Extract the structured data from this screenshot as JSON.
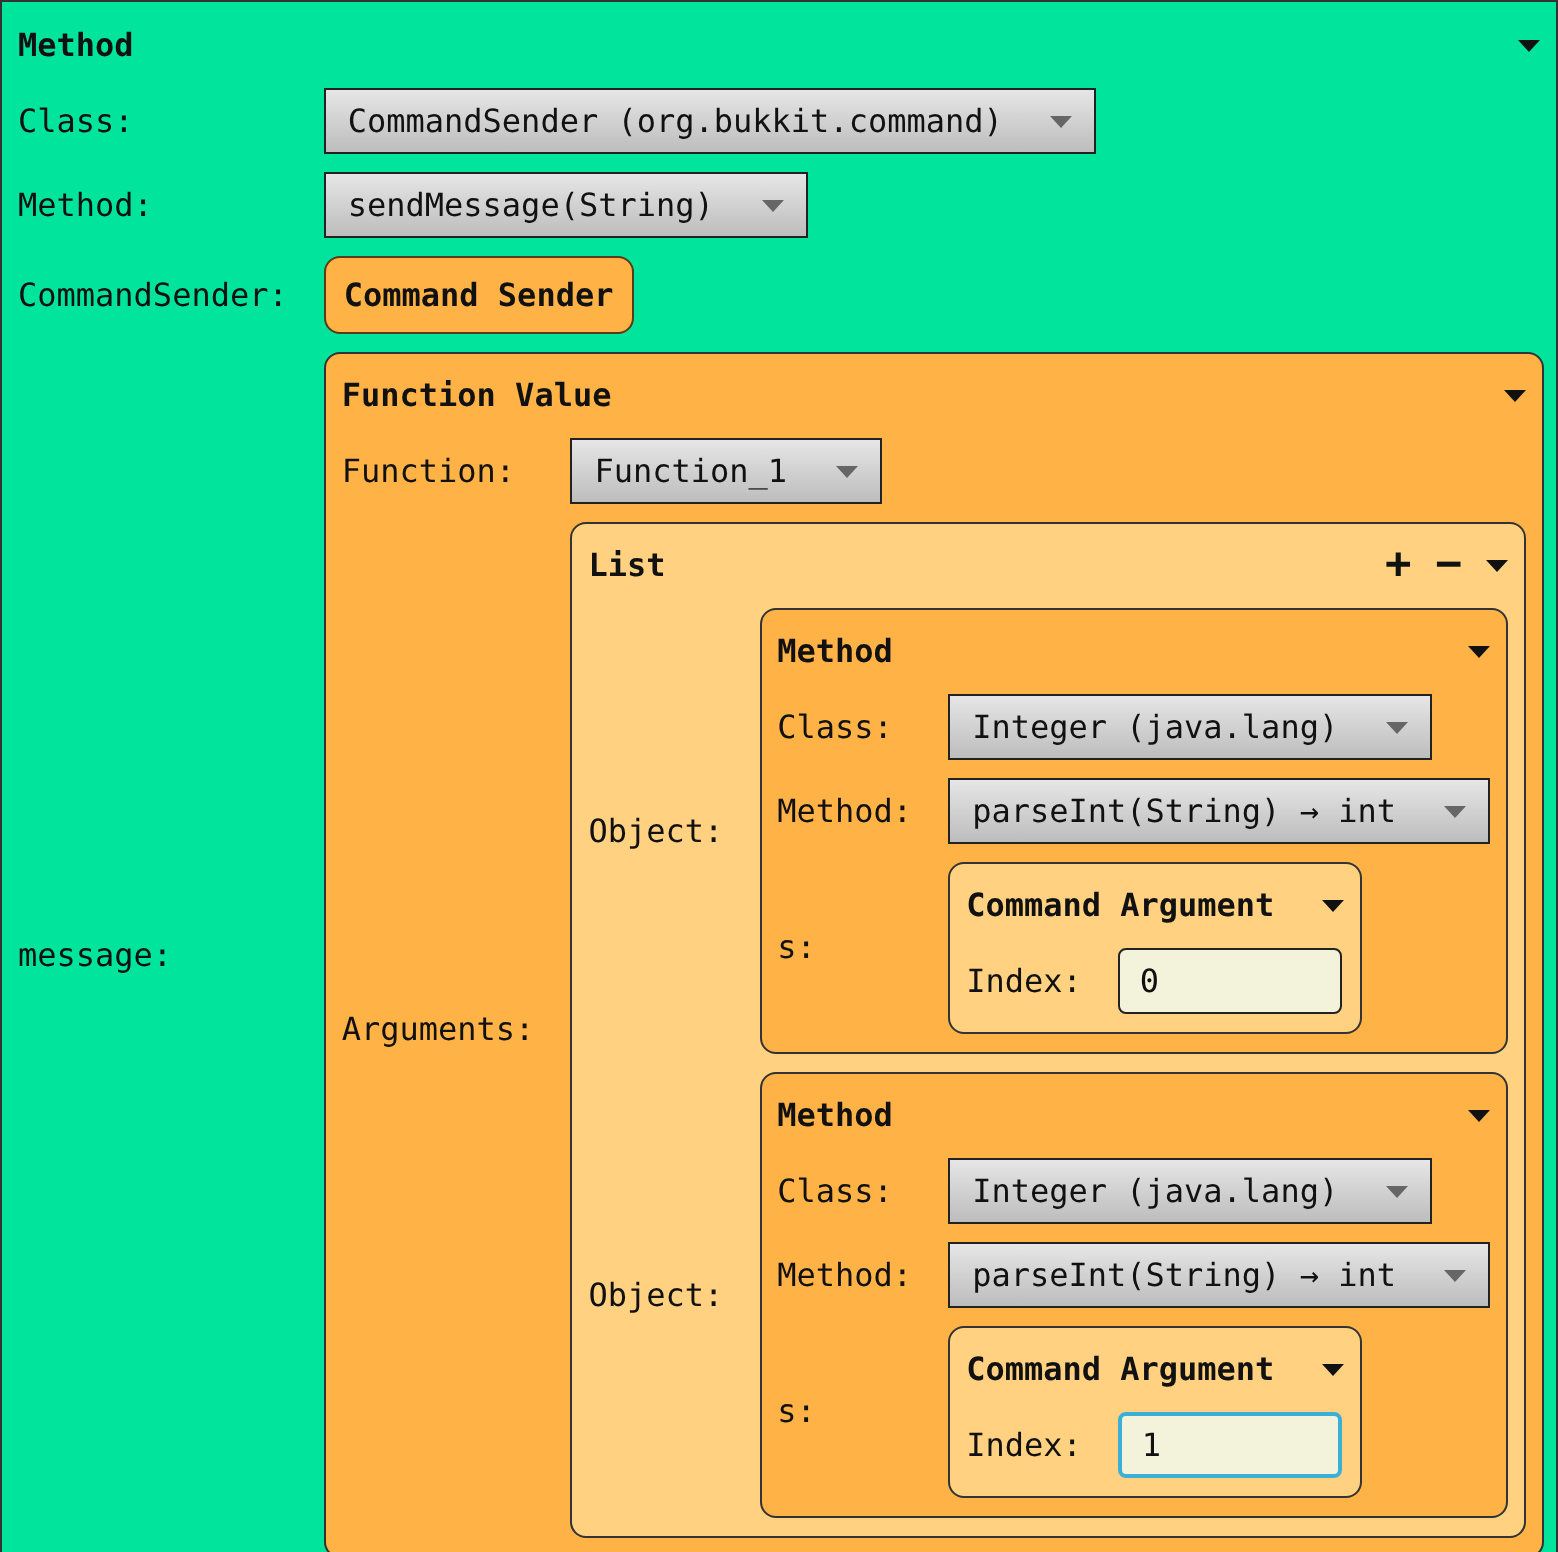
{
  "root": {
    "kind": "panel",
    "title": "Method",
    "color": "#00e59b",
    "fields": [
      {
        "label": "Class:",
        "value": {
          "kind": "dropdown",
          "text": "CommandSender (org.bukkit.command)"
        }
      },
      {
        "label": "Method:",
        "value": {
          "kind": "dropdown",
          "text": "sendMessage(String)"
        }
      },
      {
        "label": "CommandSender:",
        "value": {
          "kind": "chip",
          "text": "Command Sender",
          "color": "#ffb347"
        }
      },
      {
        "label": "message:",
        "value": {
          "kind": "panel",
          "title": "Function Value",
          "color": "#ffb347",
          "fields": [
            {
              "label": "Function:",
              "value": {
                "kind": "dropdown",
                "text": "Function_1"
              }
            },
            {
              "label": "Arguments:",
              "value": {
                "kind": "panel",
                "title": "List",
                "color": "#ffd181",
                "actions": [
                  "+",
                  "−"
                ],
                "fields": [
                  {
                    "label": "Object:",
                    "value": {
                      "kind": "panel",
                      "title": "Method",
                      "color": "#ffb347",
                      "fields": [
                        {
                          "label": "Class:",
                          "value": {
                            "kind": "dropdown",
                            "text": "Integer (java.lang)"
                          }
                        },
                        {
                          "label": "Method:",
                          "value": {
                            "kind": "dropdown",
                            "text": "parseInt(String) → int"
                          }
                        },
                        {
                          "label": "s:",
                          "value": {
                            "kind": "compact_panel",
                            "title": "Command Argument",
                            "color": "#ffd181",
                            "fields": [
                              {
                                "label": "Index:",
                                "value": {
                                  "kind": "input",
                                  "text": "0",
                                  "focused": false
                                }
                              }
                            ]
                          }
                        }
                      ]
                    }
                  },
                  {
                    "label": "Object:",
                    "value": {
                      "kind": "panel",
                      "title": "Method",
                      "color": "#ffb347",
                      "fields": [
                        {
                          "label": "Class:",
                          "value": {
                            "kind": "dropdown",
                            "text": "Integer (java.lang)"
                          }
                        },
                        {
                          "label": "Method:",
                          "value": {
                            "kind": "dropdown",
                            "text": "parseInt(String) → int"
                          }
                        },
                        {
                          "label": "s:",
                          "value": {
                            "kind": "compact_panel",
                            "title": "Command Argument",
                            "color": "#ffd181",
                            "fields": [
                              {
                                "label": "Index:",
                                "value": {
                                  "kind": "input",
                                  "text": "1",
                                  "focused": true
                                }
                              }
                            ]
                          }
                        }
                      ]
                    }
                  }
                ]
              }
            }
          ]
        }
      }
    ]
  }
}
